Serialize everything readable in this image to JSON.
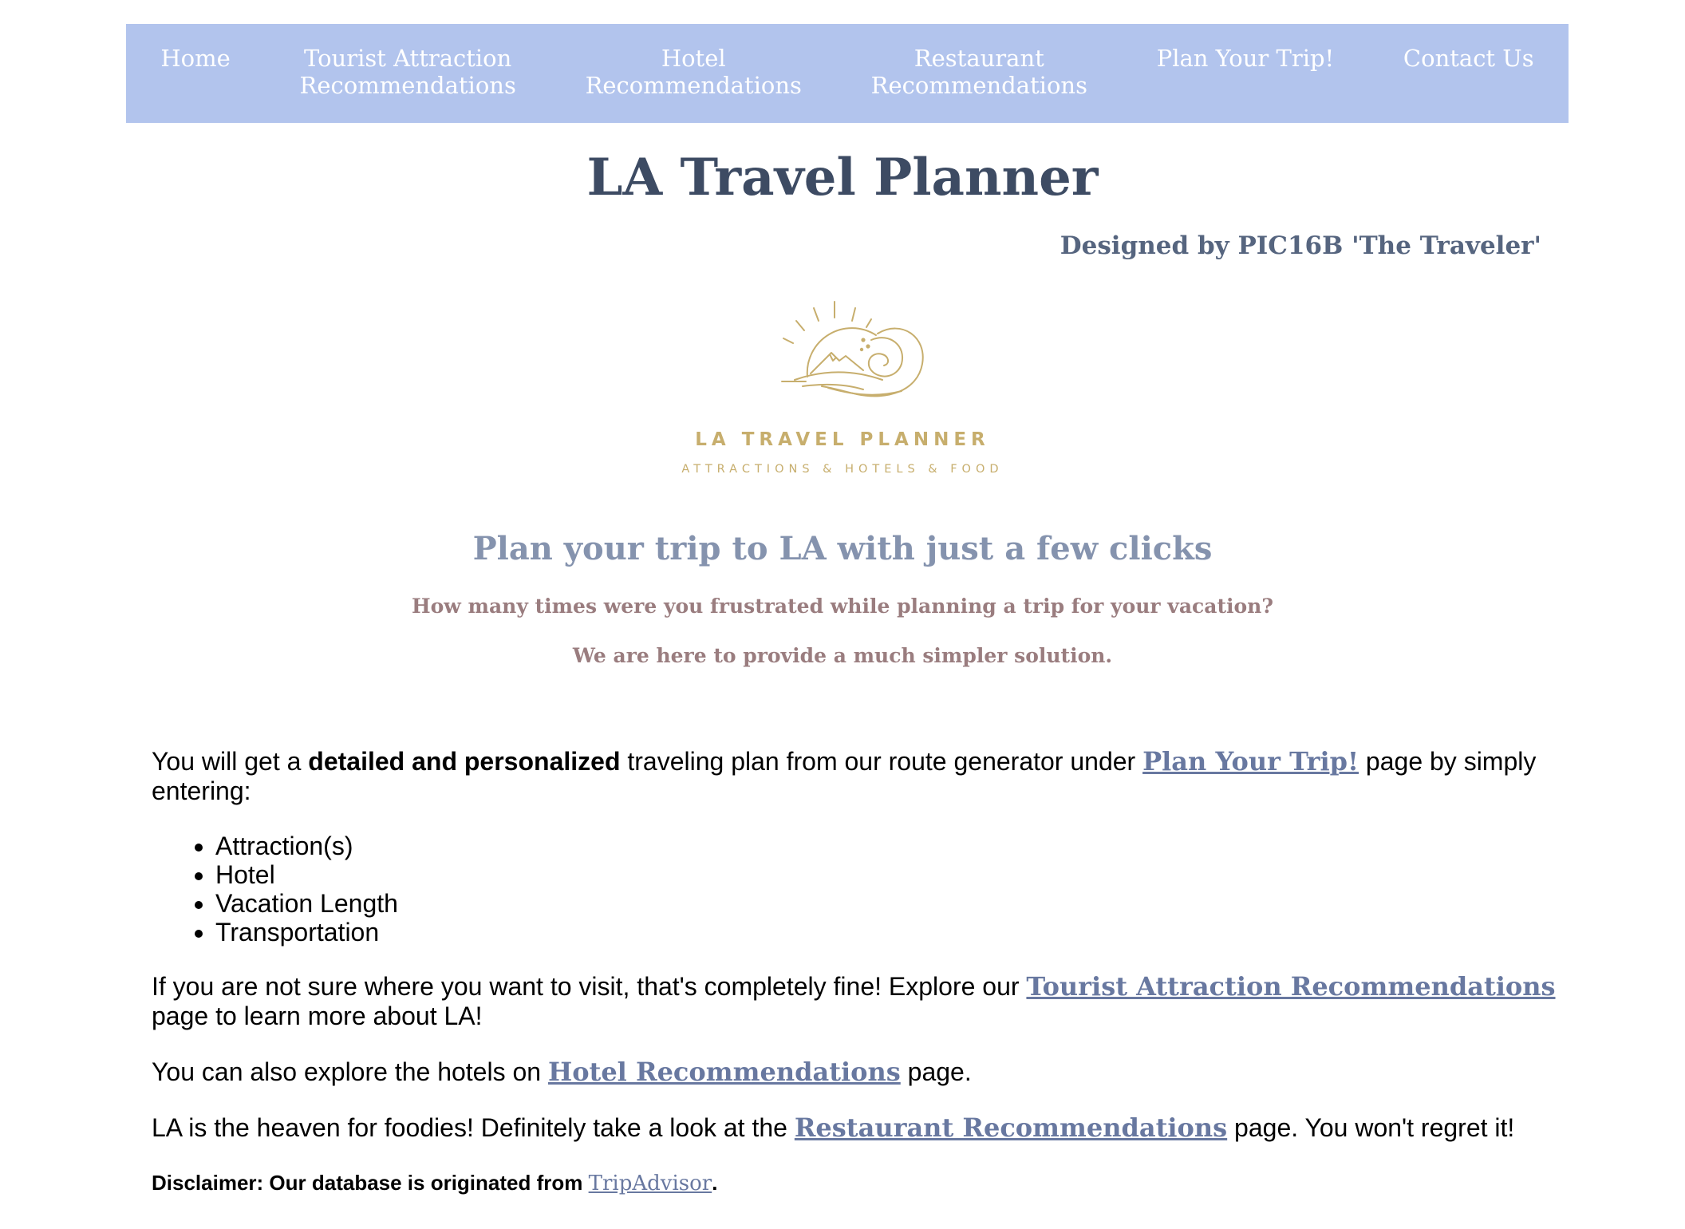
{
  "nav": {
    "items": [
      {
        "label": "Home"
      },
      {
        "label": "Tourist Attraction\nRecommendations"
      },
      {
        "label": "Hotel\nRecommendations"
      },
      {
        "label": "Restaurant\nRecommendations"
      },
      {
        "label": "Plan Your Trip!"
      },
      {
        "label": "Contact Us"
      }
    ]
  },
  "header": {
    "title": "LA Travel Planner",
    "designer": "Designed by PIC16B 'The Traveler'"
  },
  "logo": {
    "name": "LA TRAVEL PLANNER",
    "tagline": "ATTRACTIONS & HOTELS & FOOD",
    "icon": "sun-mountain-wave-logo",
    "color": "#c7ae6d"
  },
  "hero": {
    "tagline": "Plan your trip to LA with just a few clicks",
    "question": "How many times were you frustrated while planning a trip for your vacation?",
    "answer": "We are here to provide a much simpler solution."
  },
  "content": {
    "p1_prefix": "You will get a ",
    "p1_bold": "detailed and personalized",
    "p1_mid": " traveling plan from our route generator under ",
    "p1_link": "Plan Your Trip!",
    "p1_suffix": " page by simply entering:",
    "list": [
      "Attraction(s)",
      "Hotel",
      "Vacation Length",
      "Transportation"
    ],
    "p2_prefix": "If you are not sure where you want to visit, that's completely fine! Explore our ",
    "p2_link": "Tourist Attraction Recommendations",
    "p2_suffix": " page to learn more about LA!",
    "p3_prefix": "You can also explore the hotels on ",
    "p3_link": "Hotel Recommendations",
    "p3_suffix": " page.",
    "p4_prefix": "LA is the heaven for foodies! Definitely take a look at the ",
    "p4_link": "Restaurant Recommendations",
    "p4_suffix": " page. You won't regret it!",
    "disclaimer_prefix": "Disclaimer: Our database is originated from ",
    "disclaimer_link": "TripAdvisor",
    "disclaimer_suffix": "."
  },
  "colors": {
    "nav_bg": "#b2c4ed",
    "title": "#3d4b63",
    "tagline": "#8593ae",
    "sub": "#9a7d7f",
    "link": "#6878a0"
  }
}
